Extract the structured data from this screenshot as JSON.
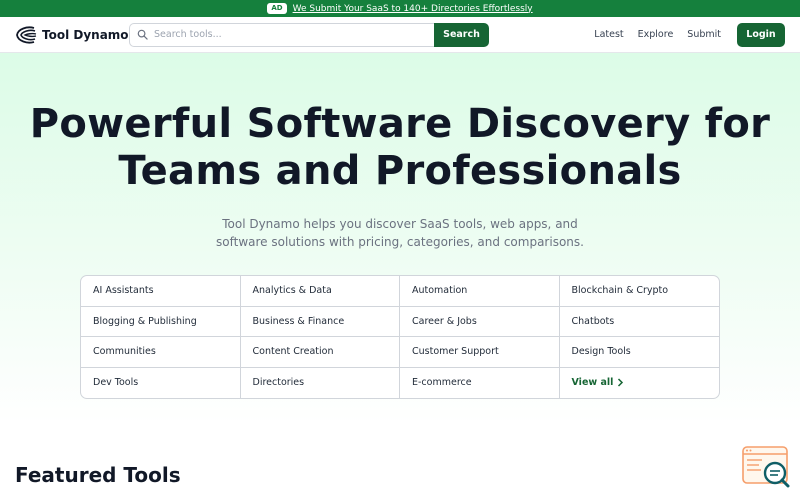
{
  "ad_bar": {
    "badge": "AD",
    "link_text": "We Submit Your SaaS to 140+ Directories Effortlessly"
  },
  "navbar": {
    "brand": "Tool Dynamo",
    "search_placeholder": "Search tools...",
    "search_button": "Search",
    "links": [
      "Latest",
      "Explore",
      "Submit"
    ],
    "login": "Login"
  },
  "hero": {
    "title_line1": "Powerful Software Discovery for",
    "title_line2": "Teams and Professionals",
    "subtitle": "Tool Dynamo helps you discover SaaS tools, web apps, and software solutions with pricing, categories, and comparisons."
  },
  "categories": [
    "AI Assistants",
    "Analytics & Data",
    "Automation",
    "Blockchain & Crypto",
    "Blogging & Publishing",
    "Business & Finance",
    "Career & Jobs",
    "Chatbots",
    "Communities",
    "Content Creation",
    "Customer Support",
    "Design Tools",
    "Dev Tools",
    "Directories",
    "E-commerce"
  ],
  "view_all": "View all",
  "featured": {
    "heading": "Featured Tools"
  },
  "colors": {
    "brand_green": "#166534",
    "ad_green": "#15803d",
    "widget_orange": "#f59e6b",
    "widget_teal": "#0f5e66"
  },
  "icons": {
    "logo": "tool-dynamo-logo",
    "search": "search-icon",
    "chevron": "chevron-right-icon",
    "widget": "search-widget-icon"
  }
}
